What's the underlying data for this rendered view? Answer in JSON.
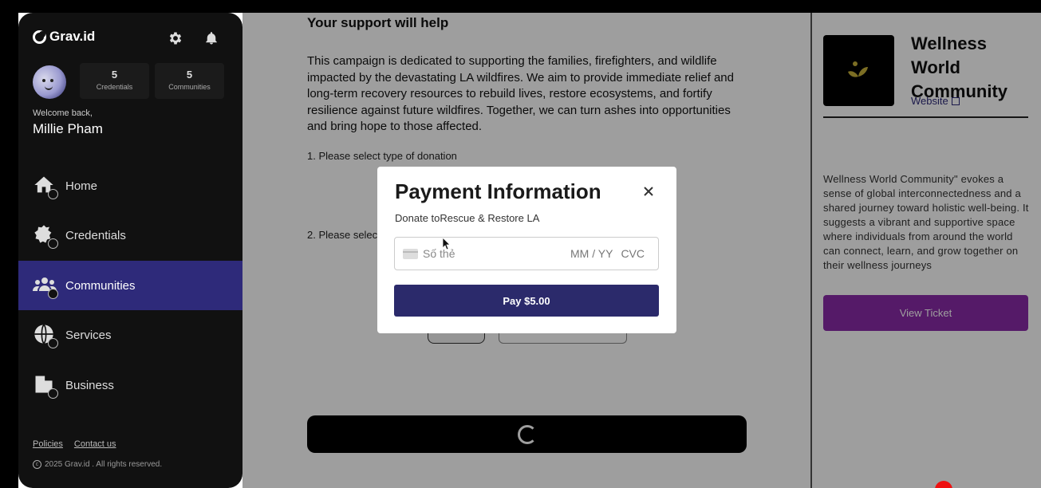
{
  "sidebar": {
    "brand": "Grav.id",
    "stats": [
      {
        "value": "5",
        "label": "Credentials"
      },
      {
        "value": "5",
        "label": "Communities"
      }
    ],
    "welcome": "Welcome back,",
    "user_name": "Millie Pham",
    "nav": [
      {
        "label": "Home",
        "icon": "home-icon",
        "active": false
      },
      {
        "label": "Credentials",
        "icon": "credential-icon",
        "active": false
      },
      {
        "label": "Communities",
        "icon": "communities-icon",
        "active": true
      },
      {
        "label": "Services",
        "icon": "globe-icon",
        "active": false
      },
      {
        "label": "Business",
        "icon": "building-icon",
        "active": false
      }
    ],
    "footer": {
      "policies": "Policies",
      "contact": "Contact us",
      "copyright": "2025 Grav.id . All rights reserved."
    }
  },
  "main": {
    "section_title": "Your support will help",
    "description": "This campaign is dedicated to supporting the families, firefighters, and wildlife impacted by the devastating LA wildfires. We aim to provide immediate relief and long-term recovery resources to rebuild lives, restore ecosystems, and fortify resilience against future wildfires. Together, we can turn ashes into opportunities and bring hope to those affected.",
    "step1": "1. Please select type of donation",
    "step2": "2. Please select"
  },
  "right_panel": {
    "org_name": "Wellness World Community",
    "website_label": "Website",
    "description": "Wellness World Community\" evokes a sense of global interconnectedness and a shared journey toward holistic well-being. It suggests a vibrant and supportive space where individuals from around the world can connect, learn, and grow together on their wellness journeys",
    "ticket_button": "View Ticket"
  },
  "modal": {
    "title": "Payment Information",
    "subtitle": "Donate toRescue & Restore LA",
    "card_placeholder": "Số thẻ",
    "expiry_placeholder": "MM / YY",
    "cvc_placeholder": "CVC",
    "pay_button": "Pay $5.00"
  },
  "colors": {
    "sidebar_bg": "#111111",
    "nav_active": "#2e2a7a",
    "pay_button": "#2b2a6b",
    "ticket_button": "#8a2aa8"
  }
}
